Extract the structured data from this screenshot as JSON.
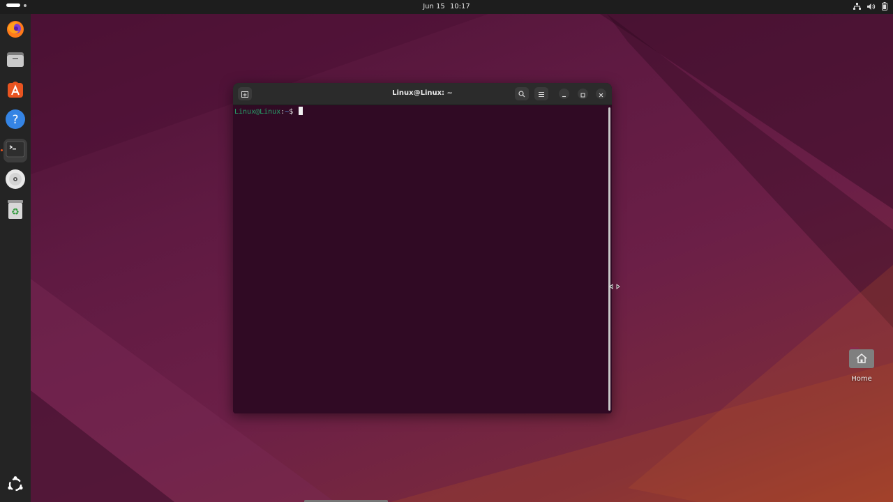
{
  "topbar": {
    "date": "Jun 15",
    "time": "10:17",
    "tray_icons": [
      "network-icon",
      "volume-icon",
      "battery-icon"
    ]
  },
  "dock": {
    "apps": [
      {
        "name": "Firefox",
        "icon": "firefox-icon"
      },
      {
        "name": "Files",
        "icon": "files-icon"
      },
      {
        "name": "App Center",
        "icon": "app-center-icon"
      },
      {
        "name": "Help",
        "icon": "help-icon"
      },
      {
        "name": "Terminal",
        "icon": "terminal-icon",
        "active": true
      },
      {
        "name": "Disc",
        "icon": "disc-icon"
      },
      {
        "name": "Trash",
        "icon": "trash-icon"
      }
    ],
    "show_apps_icon": "ubuntu-logo-icon"
  },
  "terminal": {
    "title": "Linux@Linux: ~",
    "prompt_user": "Linux@Linux",
    "prompt_sep": ":",
    "prompt_path": "~",
    "prompt_symbol": "$ "
  },
  "desktop": {
    "home_label": "Home"
  },
  "colors": {
    "terminal_bg": "#300a24",
    "prompt_user": "#26a269",
    "prompt_path": "#5b8fd6",
    "accent": "#e95420"
  }
}
